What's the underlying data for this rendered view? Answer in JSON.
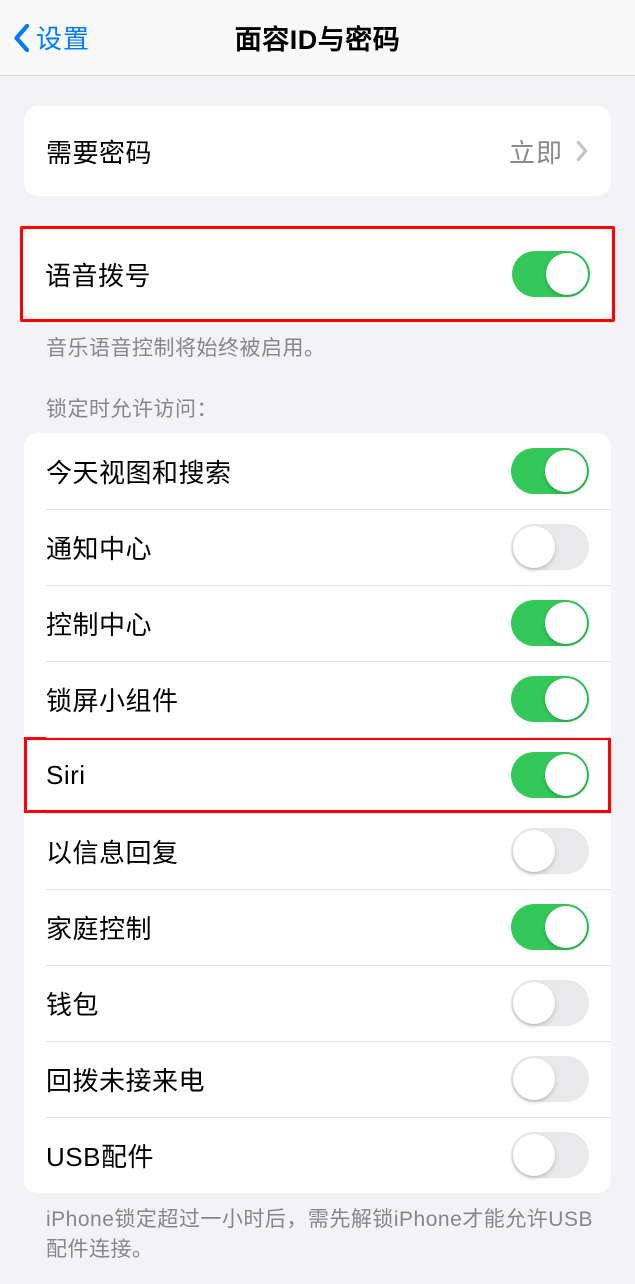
{
  "navbar": {
    "back_label": "设置",
    "title": "面容ID与密码"
  },
  "passcode_row": {
    "label": "需要密码",
    "value": "立即"
  },
  "voice_dial": {
    "label": "语音拨号",
    "on": true
  },
  "voice_dial_footnote": "音乐语音控制将始终被启用。",
  "locked_header": "锁定时允许访问：",
  "locked_items": [
    {
      "label": "今天视图和搜索",
      "on": true
    },
    {
      "label": "通知中心",
      "on": false
    },
    {
      "label": "控制中心",
      "on": true
    },
    {
      "label": "锁屏小组件",
      "on": true
    },
    {
      "label": "Siri",
      "on": true
    },
    {
      "label": "以信息回复",
      "on": false
    },
    {
      "label": "家庭控制",
      "on": true
    },
    {
      "label": "钱包",
      "on": false
    },
    {
      "label": "回拨未接来电",
      "on": false
    },
    {
      "label": "USB配件",
      "on": false
    }
  ],
  "usb_footnote": "iPhone锁定超过一小时后，需先解锁iPhone才能允许USB配件连接。",
  "highlighted": [
    "voice_dial_group",
    "locked_item_4"
  ]
}
